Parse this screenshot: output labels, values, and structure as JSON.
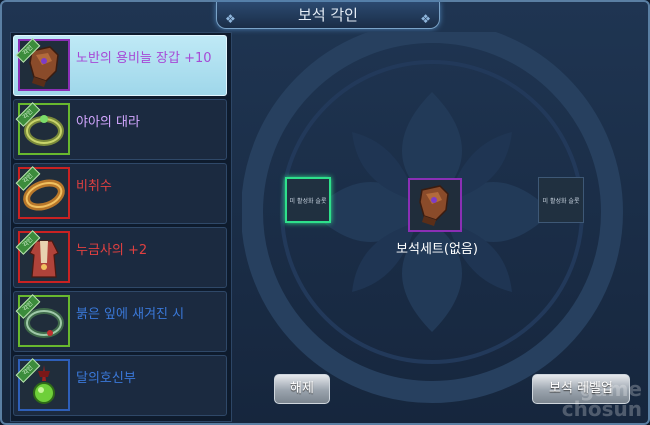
{
  "window": {
    "title": "보석 각인"
  },
  "items": [
    {
      "name": "노반의 용비늘 장갑 +10",
      "badge": "각인",
      "grade": "epic",
      "icon": "gauntlet-icon",
      "name_color": "#a64ad6",
      "selected": true
    },
    {
      "name": "야아의 대라",
      "badge": "각인",
      "grade": "uncommon",
      "icon": "ring-icon",
      "name_color": "#d2a6ff",
      "selected": false
    },
    {
      "name": "비취수",
      "badge": "각인",
      "grade": "rare-red",
      "icon": "bracelet-icon",
      "name_color": "#e04040",
      "selected": false
    },
    {
      "name": "누금사의 +2",
      "badge": "각인",
      "grade": "rare-red",
      "icon": "robe-icon",
      "name_color": "#e04040",
      "selected": false
    },
    {
      "name": "붉은 잎에 새겨진 시",
      "badge": "각인",
      "grade": "blue",
      "icon": "ring-icon",
      "name_color": "#3a78d8",
      "selected": false
    },
    {
      "name": "달의호신부",
      "badge": "각인",
      "grade": "blue",
      "icon": "amulet-icon",
      "name_color": "#3a78d8",
      "selected": false
    }
  ],
  "main": {
    "left_slot_text": "미 활성화 슬롯",
    "right_slot_text": "미 활성화 슬롯",
    "center_item_icon": "gauntlet-icon",
    "set_label": "보석세트(없음)"
  },
  "buttons": {
    "release": "해제",
    "level_up": "보석 레벨업"
  },
  "watermark": {
    "line1": "game",
    "line2": "chosun"
  },
  "colors": {
    "epic": "#8b2fb5",
    "uncommon": "#68b82e",
    "rare_red": "#c92222",
    "blue": "#2e5fb8",
    "active_slot": "#2ee08b"
  }
}
